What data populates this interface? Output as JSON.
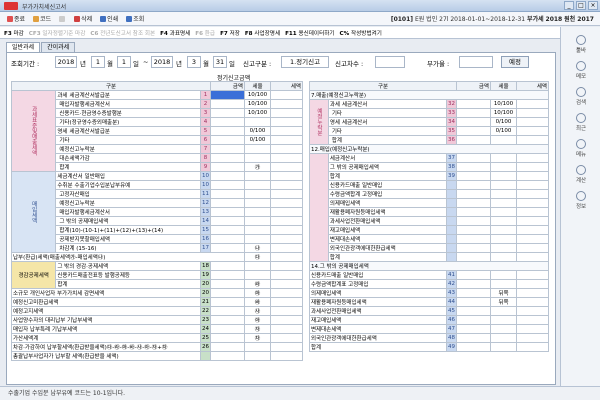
{
  "window": {
    "title": "부가가치세신고서",
    "buttons": [
      "_",
      "□",
      "×"
    ]
  },
  "toolbar": {
    "items": [
      {
        "label": "종료",
        "icon": "close-icon",
        "color": "#e05050"
      },
      {
        "label": "코드",
        "icon": "code-icon",
        "color": "#e0a040"
      },
      {
        "label": "",
        "icon": "blank-icon",
        "color": "#cccccc"
      },
      {
        "label": "삭제",
        "icon": "delete-icon",
        "color": "#d04040"
      },
      {
        "label": "인쇄",
        "icon": "print-icon",
        "color": "#4070c0"
      },
      {
        "label": "조회",
        "icon": "search-icon",
        "color": "#4070c0"
      }
    ],
    "company_code": "[0101]",
    "company_name": "E원 법인",
    "period_info": "27l 2018-01-01~2018-12-31",
    "tax_label": "부가세",
    "tax_year": "2018",
    "version": "원천 2017"
  },
  "fnbar": {
    "items": [
      {
        "key": "F3",
        "label": "마감",
        "dim": false
      },
      {
        "key": "CF3",
        "label": "일자정렬기준 마감",
        "dim": true
      },
      {
        "key": "C6",
        "label": "전년도신고서 참조 회본",
        "dim": true
      },
      {
        "key": "F4",
        "label": "과표명세",
        "dim": false
      },
      {
        "key": "F6",
        "label": "환급",
        "dim": true
      },
      {
        "key": "F7",
        "label": "저장",
        "dim": false
      },
      {
        "key": "F8",
        "label": "사업장명세",
        "dim": false
      },
      {
        "key": "F11",
        "label": "용신데이터하기",
        "dim": false
      },
      {
        "key": "C%",
        "label": "작성방법켜기",
        "dim": false
      }
    ]
  },
  "tabs": [
    "일반과세",
    "간이과세"
  ],
  "filter": {
    "period_label": "조회기간 :",
    "year_from": "2018",
    "unit_year": "년",
    "month_from": "1",
    "unit_month": "월",
    "day_from": "1",
    "unit_day": "일",
    "tilde": "~",
    "year_to": "2018",
    "month_to": "3",
    "day_to": "31",
    "report_type_label": "신고구분 :",
    "report_type": "1.정기신고",
    "report_seq_label": "신고차수 :",
    "report_seq": "",
    "vat_rate_label": "부가율 :",
    "vat_rate": "",
    "example_button": "예정"
  },
  "left_table": {
    "caption": "정기신고금액",
    "headers": [
      "구분",
      "",
      "금액",
      "세율",
      "세액"
    ],
    "rows": [
      {
        "side": "과세표준및매출세액",
        "group": "과세",
        "label": "세금계산서발급분",
        "no": "1",
        "rate": "10/100"
      },
      {
        "side": "",
        "group": "",
        "label": "매입자발행세금계산서",
        "no": "2",
        "rate": "10/100"
      },
      {
        "side": "",
        "group": "",
        "label": "신용카드·현금영수증발행분",
        "no": "3",
        "rate": "10/100"
      },
      {
        "side": "",
        "group": "",
        "label": "기타(정규영수증외매출분)",
        "no": "4",
        "rate": ""
      },
      {
        "side": "",
        "group": "영세",
        "label": "세금계산서발급분",
        "no": "5",
        "rate": "0/100"
      },
      {
        "side": "",
        "group": "",
        "label": "기타",
        "no": "6",
        "rate": "0/100"
      },
      {
        "side": "",
        "group": "",
        "label": "예정신고누락분",
        "no": "7",
        "rate": ""
      },
      {
        "side": "",
        "group": "",
        "label": "대손세액가감",
        "no": "8",
        "rate": ""
      },
      {
        "side": "",
        "group": "",
        "label": "합계",
        "no": "9",
        "rate": "㉮"
      },
      {
        "side": "매입세액",
        "group": "세금계산서",
        "label": "일반매입",
        "no": "10",
        "rate": ""
      },
      {
        "side": "",
        "group": "수취분",
        "label": "수출기업수입분납부유예",
        "no": "10",
        "rate": ""
      },
      {
        "side": "",
        "group": "",
        "label": "고정자산매입",
        "no": "11",
        "rate": ""
      },
      {
        "side": "",
        "group": "",
        "label": "예정신고누락분",
        "no": "12",
        "rate": ""
      },
      {
        "side": "",
        "group": "",
        "label": "매입자발행세금계산서",
        "no": "13",
        "rate": ""
      },
      {
        "side": "",
        "group": "",
        "label": "그 밖의 공제매입세액",
        "no": "14",
        "rate": ""
      },
      {
        "side": "",
        "group": "",
        "label": "합계(10)-(10-1)+(11)+(12)+(13)+(14)",
        "no": "15",
        "rate": ""
      },
      {
        "side": "",
        "group": "",
        "label": "공제받지못할매입세액",
        "no": "16",
        "rate": ""
      },
      {
        "side": "",
        "group": "",
        "label": "차감계 (15-16)",
        "no": "17",
        "rate": "㉯"
      }
    ],
    "payable": {
      "label": "납부(환급)세액(매출세액㉮-매입세액㉯)",
      "mark": "㉰"
    },
    "lower_rows": [
      {
        "side": "경감공제세액",
        "label": "그 밖의 경감·공제세액",
        "no": "18",
        "rate": ""
      },
      {
        "side": "",
        "label": "신용카드매출전표등 발행공제등",
        "no": "19",
        "rate": ""
      },
      {
        "side": "",
        "label": "합계",
        "no": "20",
        "rate": "㉱"
      },
      {
        "side": "",
        "label": "소규모 개인사업자 부가가치세 감면세액",
        "no": "20",
        "rate": "㉲"
      },
      {
        "side": "",
        "label": "예정신고미환급세액",
        "no": "21",
        "rate": "㉳"
      },
      {
        "side": "",
        "label": "예정고지세액",
        "no": "22",
        "rate": "㉴"
      },
      {
        "side": "",
        "label": "사업양수자의 대리납부 기납부세액",
        "no": "23",
        "rate": "㉵"
      },
      {
        "side": "",
        "label": "매입자 납부특례 기납부세액",
        "no": "24",
        "rate": "㉶"
      },
      {
        "side": "",
        "label": "가산세액계",
        "no": "25",
        "rate": "㉷"
      },
      {
        "side": "",
        "label": "차감·가감하여 납부할세액(환급받을세액)㉰-㉱-㉲-㉳-㉴-㉵-㉶+㉷",
        "no": "26",
        "rate": ""
      },
      {
        "side": "",
        "label": "총괄납부사업자가 납부할 세액(환급받을 세액)",
        "no": "",
        "rate": ""
      }
    ]
  },
  "right_table": {
    "headers": [
      "구분",
      "",
      "금액",
      "세율",
      "세액"
    ],
    "section7": "7.매출(예정신고누락분)",
    "rows7": [
      {
        "side": "예정누락분",
        "group": "과세",
        "label": "세금계산서",
        "no": "32",
        "rate": "10/100"
      },
      {
        "side": "",
        "group": "",
        "label": "기타",
        "no": "33",
        "rate": "10/100"
      },
      {
        "side": "",
        "group": "영세",
        "label": "세금계산서",
        "no": "34",
        "rate": "0/100"
      },
      {
        "side": "",
        "group": "",
        "label": "기타",
        "no": "35",
        "rate": "0/100"
      },
      {
        "side": "",
        "group": "",
        "label": "합계",
        "no": "36",
        "rate": ""
      }
    ],
    "section12": "12.매입(예정신고누락분)",
    "rows12": [
      {
        "label": "세금계산서",
        "no": "37"
      },
      {
        "label": "그 밖의 공제매입세액",
        "no": "38"
      },
      {
        "label": "합계",
        "no": "39"
      },
      {
        "label": "신용카드매출 일반매입",
        "no": ""
      },
      {
        "label": "수령금액합계 고정매입",
        "no": ""
      },
      {
        "label": "의제매입세액",
        "no": ""
      },
      {
        "label": "재활용폐자원등매입세액",
        "no": ""
      },
      {
        "label": "과세사업전환매입세액",
        "no": ""
      },
      {
        "label": "재고매입세액",
        "no": ""
      },
      {
        "label": "변제대손세액",
        "no": ""
      },
      {
        "label": "외국인관광객에대한환급세액",
        "no": ""
      },
      {
        "label": "합계",
        "no": ""
      }
    ],
    "section14": "14.그 밖의 공제매입세액",
    "rows14": [
      {
        "label": "신용카드매출 일반매입",
        "no": "41",
        "rate": ""
      },
      {
        "label": "수령금액합계표 고정매입",
        "no": "42",
        "rate": ""
      },
      {
        "label": "의제매입세액",
        "no": "43",
        "rate": "뒤쪽"
      },
      {
        "label": "재활용폐자원등매입세액",
        "no": "44",
        "rate": "뒤쪽"
      },
      {
        "label": "과세사업전환매입세액",
        "no": "45",
        "rate": ""
      },
      {
        "label": "재고매입세액",
        "no": "46",
        "rate": ""
      },
      {
        "label": "변제대손세액",
        "no": "47",
        "rate": ""
      },
      {
        "label": "외국인관광객에대한환급세액",
        "no": "48",
        "rate": ""
      },
      {
        "label": "합계",
        "no": "49",
        "rate": ""
      }
    ]
  },
  "sidebar": [
    "툴바",
    "메모",
    "검색",
    "최근",
    "메뉴",
    "계산",
    "정보"
  ],
  "statusbar": {
    "text": "수출기업 수입분 납부유예 코드는 10-1입니다."
  }
}
